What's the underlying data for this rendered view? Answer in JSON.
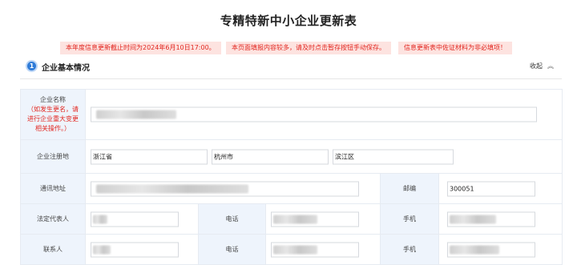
{
  "page": {
    "title": "专精特新中小企业更新表"
  },
  "notices": [
    "本年度信息更新截止时间为2024年6月10日17:00。",
    "本页面填报内容较多，请及时点击暂存按钮手动保存。",
    "信息更新表中佐证材料为非必填项！"
  ],
  "section": {
    "number": "1",
    "title": "企业基本情况",
    "collapse_label": "收起",
    "collapse_icon": "double-chevron-up-icon"
  },
  "company_name": {
    "label": "企业名称",
    "note": "（如发生更名，请进行企业重大变更相关操作。）",
    "value": ""
  },
  "registered_place": {
    "label": "企业注册地",
    "province": "浙江省",
    "city": "杭州市",
    "district": "滨江区"
  },
  "address": {
    "label": "通讯地址",
    "value": ""
  },
  "postcode": {
    "label": "邮编",
    "value": "300051"
  },
  "legal_rep": {
    "label": "法定代表人",
    "phone_label": "电话",
    "mobile_label": "手机"
  },
  "contact": {
    "label": "联系人",
    "phone_label": "电话",
    "mobile_label": "手机"
  },
  "colors": {
    "accent": "#2e7bd8",
    "notice_text": "#e2261f",
    "notice_bg": "#fde3e0",
    "label_bg": "#eef4fc"
  }
}
